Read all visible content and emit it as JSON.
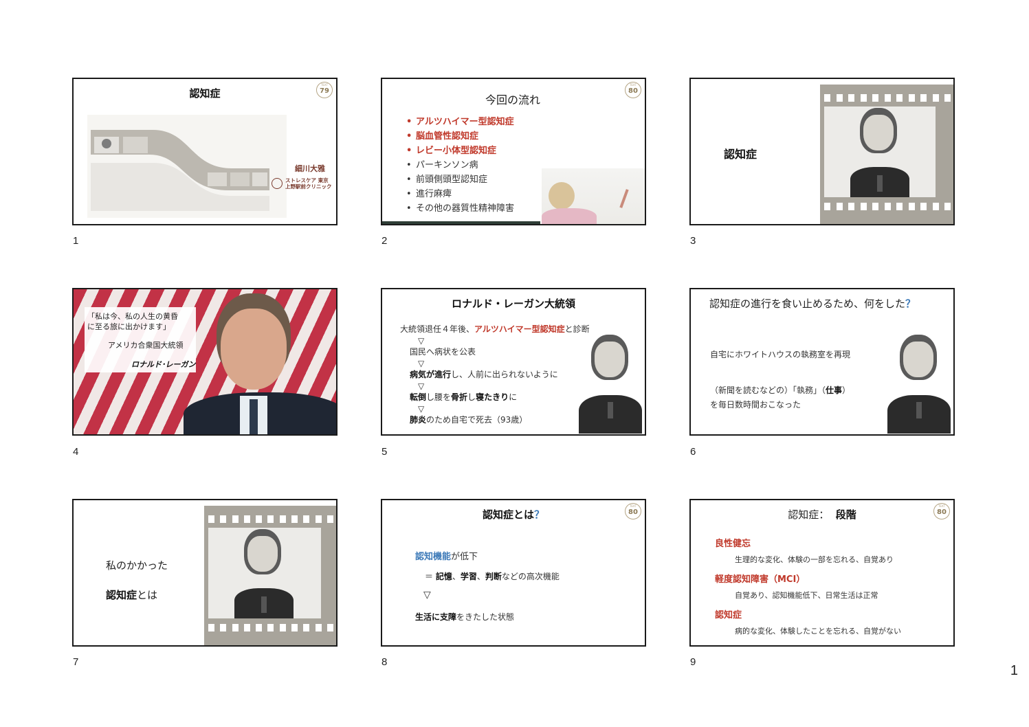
{
  "page_number": "1",
  "slides": [
    {
      "number": "1",
      "title": "認知症",
      "badge_top": "TEXT",
      "badge_num": "79",
      "author": "細川大雅",
      "clinic_line1": "ストレスケア 東京",
      "clinic_line2": "上野駅前クリニック"
    },
    {
      "number": "2",
      "title": "今回の流れ",
      "badge_top": "TEXT",
      "badge_num": "80",
      "items": [
        {
          "text": "アルツハイマー型認知症",
          "highlight": true
        },
        {
          "text": "脳血管性認知症",
          "highlight": true
        },
        {
          "text": "レビー小体型認知症",
          "highlight": true
        },
        {
          "text": "パーキンソン病",
          "highlight": false
        },
        {
          "text": "前頭側頭型認知症",
          "highlight": false
        },
        {
          "text": "進行麻痺",
          "highlight": false
        },
        {
          "text": "その他の器質性精神障害",
          "highlight": false
        }
      ]
    },
    {
      "number": "3",
      "title": "認知症"
    },
    {
      "number": "4",
      "quote_line1": "「私は今、私の人生の黄昏",
      "quote_line2": "に至る旅に出かけます」",
      "role": "アメリカ合衆国大統領",
      "name": "ロナルド･レーガン"
    },
    {
      "number": "5",
      "title": "ロナルド・レーガン大統領",
      "l1a": "大統領退任４年後、",
      "l1b": "アルツハイマー型認知症",
      "l1c": "と診断",
      "arrow": "▽",
      "l2": "国民へ病状を公表",
      "l3a": "病気が進行",
      "l3b": "し、人前に出られないように",
      "l4a": "転倒",
      "l4b": "し腰を",
      "l4c": "骨折",
      "l4d": "し",
      "l4e": "寝たきり",
      "l4f": "に",
      "l5a": "肺炎",
      "l5b": "のため自宅で死去（93歳）"
    },
    {
      "number": "6",
      "title": "認知症の進行を食い止めるため、何をした",
      "qmark": "？",
      "line1": "自宅にホワイトハウスの執務室を再現",
      "line2a": "（新聞を読むなどの）「執務」（",
      "line2b": "仕事",
      "line2c": "）",
      "line3": "を毎日数時間おこなった"
    },
    {
      "number": "7",
      "line1": "私のかかった",
      "line2a": "認知症",
      "line2b": "とは"
    },
    {
      "number": "8",
      "title": "認知症とは",
      "qmark": "？",
      "badge_top": "TEXT",
      "badge_num": "80",
      "l1a": "認知機能",
      "l1b": "が低下",
      "l2a": "＝ ",
      "l2b": "記憶",
      "l2c": "、",
      "l2d": "学習",
      "l2e": "、",
      "l2f": "判断",
      "l2g": "などの高次機能",
      "arrow": "▽",
      "l3a": "生活に支障",
      "l3b": "をきたした状態"
    },
    {
      "number": "9",
      "title_a": "認知症：",
      "title_b": "段階",
      "badge_top": "TEXT",
      "badge_num": "80",
      "h1": "良性健忘",
      "d1": "生理的な変化、体験の一部を忘れる、自覚あり",
      "h2": "軽度認知障害（MCI）",
      "d2": "自覚あり、認知機能低下、日常生活は正常",
      "h3": "認知症",
      "d3": "病的な変化、体験したことを忘れる、自覚がない"
    }
  ]
}
